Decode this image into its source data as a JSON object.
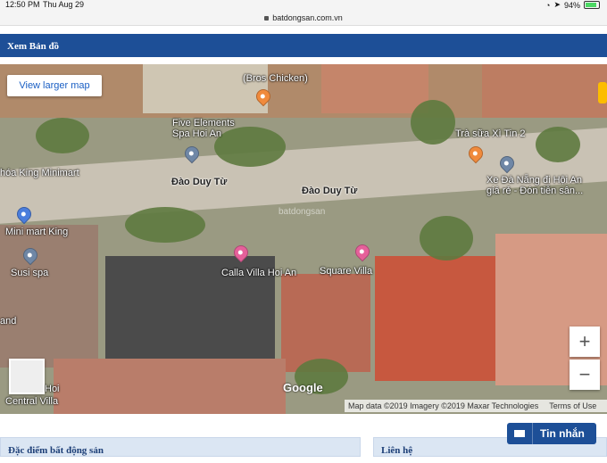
{
  "status_bar": {
    "time": "12:50 PM",
    "date": "Thu Aug 29",
    "battery": "94%"
  },
  "browser": {
    "url": "batdongsan.com.vn"
  },
  "map_header": {
    "title": "Xem Bản đồ"
  },
  "map": {
    "view_larger_label": "View larger map",
    "labels": {
      "bros_chicken": "(Bros Chicken)",
      "five_elements": "Five Elements\nSpa Hoi An",
      "tra_sua": "Trà sữa Xì Tin 2",
      "xe_da_nang": "Xe Đà Nẵng đi Hội An\ngiá rẻ - Đón tiễn sân...",
      "king_minimart_partial": "hóa King Minimart",
      "dao_duy_tu_1": "Đào Duy Từ",
      "dao_duy_tu_2": "Đào Duy Từ",
      "mini_mart_king": "Mini mart King",
      "susi_spa": "Susi spa",
      "calla_villa": "Calla Villa Hoi An",
      "square_villa": "Square Villa",
      "and_partial": "and",
      "hoi_partial": "Hoi",
      "central_villa_partial": "Central Villa",
      "watermark": "batdongsan"
    },
    "zoom_in": "+",
    "zoom_out": "−",
    "google_logo": "Google",
    "attribution": {
      "map_data": "Map data ©2019 Imagery ©2019 Maxar Technologies",
      "terms": "Terms of Use"
    }
  },
  "sections": {
    "left_title": "Đặc điểm bất động sản",
    "right_title": "Liên hệ"
  },
  "chat_button": {
    "label": "Tin nhắn"
  },
  "colors": {
    "header_blue": "#1d4f97",
    "section_bg": "#dbe6f3"
  }
}
